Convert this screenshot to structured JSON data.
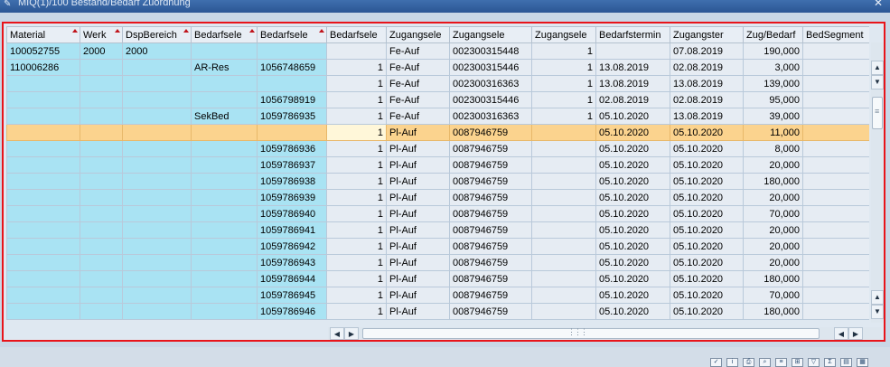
{
  "window": {
    "title": "MIQ(1)/100 Bestand/Bedarf Zuordnung"
  },
  "columns": [
    {
      "key": "material",
      "label": "Material",
      "sorted": true,
      "align": "left"
    },
    {
      "key": "werk",
      "label": "Werk",
      "sorted": true,
      "align": "left"
    },
    {
      "key": "dsp",
      "label": "DspBereich",
      "sorted": true,
      "align": "left"
    },
    {
      "key": "bed1",
      "label": "Bedarfsele",
      "sorted": true,
      "align": "left"
    },
    {
      "key": "bed2",
      "label": "Bedarfsele",
      "sorted": true,
      "align": "left"
    },
    {
      "key": "bed3",
      "label": "Bedarfsele",
      "sorted": false,
      "align": "right"
    },
    {
      "key": "zug1",
      "label": "Zugangsele",
      "sorted": false,
      "align": "left"
    },
    {
      "key": "zug2",
      "label": "Zugangsele",
      "sorted": false,
      "align": "left"
    },
    {
      "key": "zug3",
      "label": "Zugangsele",
      "sorted": false,
      "align": "right"
    },
    {
      "key": "bedtermin",
      "label": "Bedarfstermin",
      "sorted": false,
      "align": "left"
    },
    {
      "key": "zugter",
      "label": "Zugangster",
      "sorted": false,
      "align": "left"
    },
    {
      "key": "zugbed",
      "label": "Zug/Bedarf",
      "sorted": false,
      "align": "right"
    },
    {
      "key": "bedseg",
      "label": "BedSegment",
      "sorted": false,
      "align": "left"
    }
  ],
  "rows": [
    {
      "material": "100052755",
      "werk": "2000",
      "dsp": "2000",
      "bed1": "",
      "bed2": "",
      "bed3": "",
      "zug1": "Fe-Auf",
      "zug2": "002300315448",
      "zug3": "1",
      "bedtermin": "",
      "zugter": "07.08.2019",
      "zugbed": "190,000",
      "bedseg": ""
    },
    {
      "material": "110006286",
      "werk": "",
      "dsp": "",
      "bed1": "AR-Res",
      "bed2": "1056748659",
      "bed3": "1",
      "zug1": "Fe-Auf",
      "zug2": "002300315446",
      "zug3": "1",
      "bedtermin": "13.08.2019",
      "zugter": "02.08.2019",
      "zugbed": "3,000",
      "bedseg": ""
    },
    {
      "material": "",
      "werk": "",
      "dsp": "",
      "bed1": "",
      "bed2": "",
      "bed3": "1",
      "zug1": "Fe-Auf",
      "zug2": "002300316363",
      "zug3": "1",
      "bedtermin": "13.08.2019",
      "zugter": "13.08.2019",
      "zugbed": "139,000",
      "bedseg": ""
    },
    {
      "material": "",
      "werk": "",
      "dsp": "",
      "bed1": "",
      "bed2": "1056798919",
      "bed3": "1",
      "zug1": "Fe-Auf",
      "zug2": "002300315446",
      "zug3": "1",
      "bedtermin": "02.08.2019",
      "zugter": "02.08.2019",
      "zugbed": "95,000",
      "bedseg": ""
    },
    {
      "material": "",
      "werk": "",
      "dsp": "",
      "bed1": "SekBed",
      "bed2": "1059786935",
      "bed3": "1",
      "zug1": "Fe-Auf",
      "zug2": "002300316363",
      "zug3": "1",
      "bedtermin": "05.10.2020",
      "zugter": "13.08.2019",
      "zugbed": "39,000",
      "bedseg": ""
    },
    {
      "material": "",
      "werk": "",
      "dsp": "",
      "bed1": "",
      "bed2": "",
      "bed3": "1",
      "zug1": "Pl-Auf",
      "zug2": "0087946759",
      "zug3": "",
      "bedtermin": "05.10.2020",
      "zugter": "05.10.2020",
      "zugbed": "11,000",
      "bedseg": "",
      "selected": true
    },
    {
      "material": "",
      "werk": "",
      "dsp": "",
      "bed1": "",
      "bed2": "1059786936",
      "bed3": "1",
      "zug1": "Pl-Auf",
      "zug2": "0087946759",
      "zug3": "",
      "bedtermin": "05.10.2020",
      "zugter": "05.10.2020",
      "zugbed": "8,000",
      "bedseg": ""
    },
    {
      "material": "",
      "werk": "",
      "dsp": "",
      "bed1": "",
      "bed2": "1059786937",
      "bed3": "1",
      "zug1": "Pl-Auf",
      "zug2": "0087946759",
      "zug3": "",
      "bedtermin": "05.10.2020",
      "zugter": "05.10.2020",
      "zugbed": "20,000",
      "bedseg": ""
    },
    {
      "material": "",
      "werk": "",
      "dsp": "",
      "bed1": "",
      "bed2": "1059786938",
      "bed3": "1",
      "zug1": "Pl-Auf",
      "zug2": "0087946759",
      "zug3": "",
      "bedtermin": "05.10.2020",
      "zugter": "05.10.2020",
      "zugbed": "180,000",
      "bedseg": ""
    },
    {
      "material": "",
      "werk": "",
      "dsp": "",
      "bed1": "",
      "bed2": "1059786939",
      "bed3": "1",
      "zug1": "Pl-Auf",
      "zug2": "0087946759",
      "zug3": "",
      "bedtermin": "05.10.2020",
      "zugter": "05.10.2020",
      "zugbed": "20,000",
      "bedseg": ""
    },
    {
      "material": "",
      "werk": "",
      "dsp": "",
      "bed1": "",
      "bed2": "1059786940",
      "bed3": "1",
      "zug1": "Pl-Auf",
      "zug2": "0087946759",
      "zug3": "",
      "bedtermin": "05.10.2020",
      "zugter": "05.10.2020",
      "zugbed": "70,000",
      "bedseg": ""
    },
    {
      "material": "",
      "werk": "",
      "dsp": "",
      "bed1": "",
      "bed2": "1059786941",
      "bed3": "1",
      "zug1": "Pl-Auf",
      "zug2": "0087946759",
      "zug3": "",
      "bedtermin": "05.10.2020",
      "zugter": "05.10.2020",
      "zugbed": "20,000",
      "bedseg": ""
    },
    {
      "material": "",
      "werk": "",
      "dsp": "",
      "bed1": "",
      "bed2": "1059786942",
      "bed3": "1",
      "zug1": "Pl-Auf",
      "zug2": "0087946759",
      "zug3": "",
      "bedtermin": "05.10.2020",
      "zugter": "05.10.2020",
      "zugbed": "20,000",
      "bedseg": ""
    },
    {
      "material": "",
      "werk": "",
      "dsp": "",
      "bed1": "",
      "bed2": "1059786943",
      "bed3": "1",
      "zug1": "Pl-Auf",
      "zug2": "0087946759",
      "zug3": "",
      "bedtermin": "05.10.2020",
      "zugter": "05.10.2020",
      "zugbed": "20,000",
      "bedseg": ""
    },
    {
      "material": "",
      "werk": "",
      "dsp": "",
      "bed1": "",
      "bed2": "1059786944",
      "bed3": "1",
      "zug1": "Pl-Auf",
      "zug2": "0087946759",
      "zug3": "",
      "bedtermin": "05.10.2020",
      "zugter": "05.10.2020",
      "zugbed": "180,000",
      "bedseg": ""
    },
    {
      "material": "",
      "werk": "",
      "dsp": "",
      "bed1": "",
      "bed2": "1059786945",
      "bed3": "1",
      "zug1": "Pl-Auf",
      "zug2": "0087946759",
      "zug3": "",
      "bedtermin": "05.10.2020",
      "zugter": "05.10.2020",
      "zugbed": "70,000",
      "bedseg": ""
    },
    {
      "material": "",
      "werk": "",
      "dsp": "",
      "bed1": "",
      "bed2": "1059786946",
      "bed3": "1",
      "zug1": "Pl-Auf",
      "zug2": "0087946759",
      "zug3": "",
      "bedtermin": "05.10.2020",
      "zugter": "05.10.2020",
      "zugbed": "180,000",
      "bedseg": ""
    }
  ],
  "icons": {
    "window": "edit-icon",
    "close": "close-icon",
    "scroll_up": "scroll-up-icon",
    "scroll_down": "scroll-down-icon",
    "scroll_left": "scroll-left-icon",
    "scroll_right": "scroll-right-icon"
  },
  "colors": {
    "key_column_bg": "#a9e3f3",
    "value_cell_bg": "#e6ecf3",
    "selected_row_bg": "#fbd38e",
    "frame_border": "#e8141a",
    "title_bar": "#2b5694"
  }
}
